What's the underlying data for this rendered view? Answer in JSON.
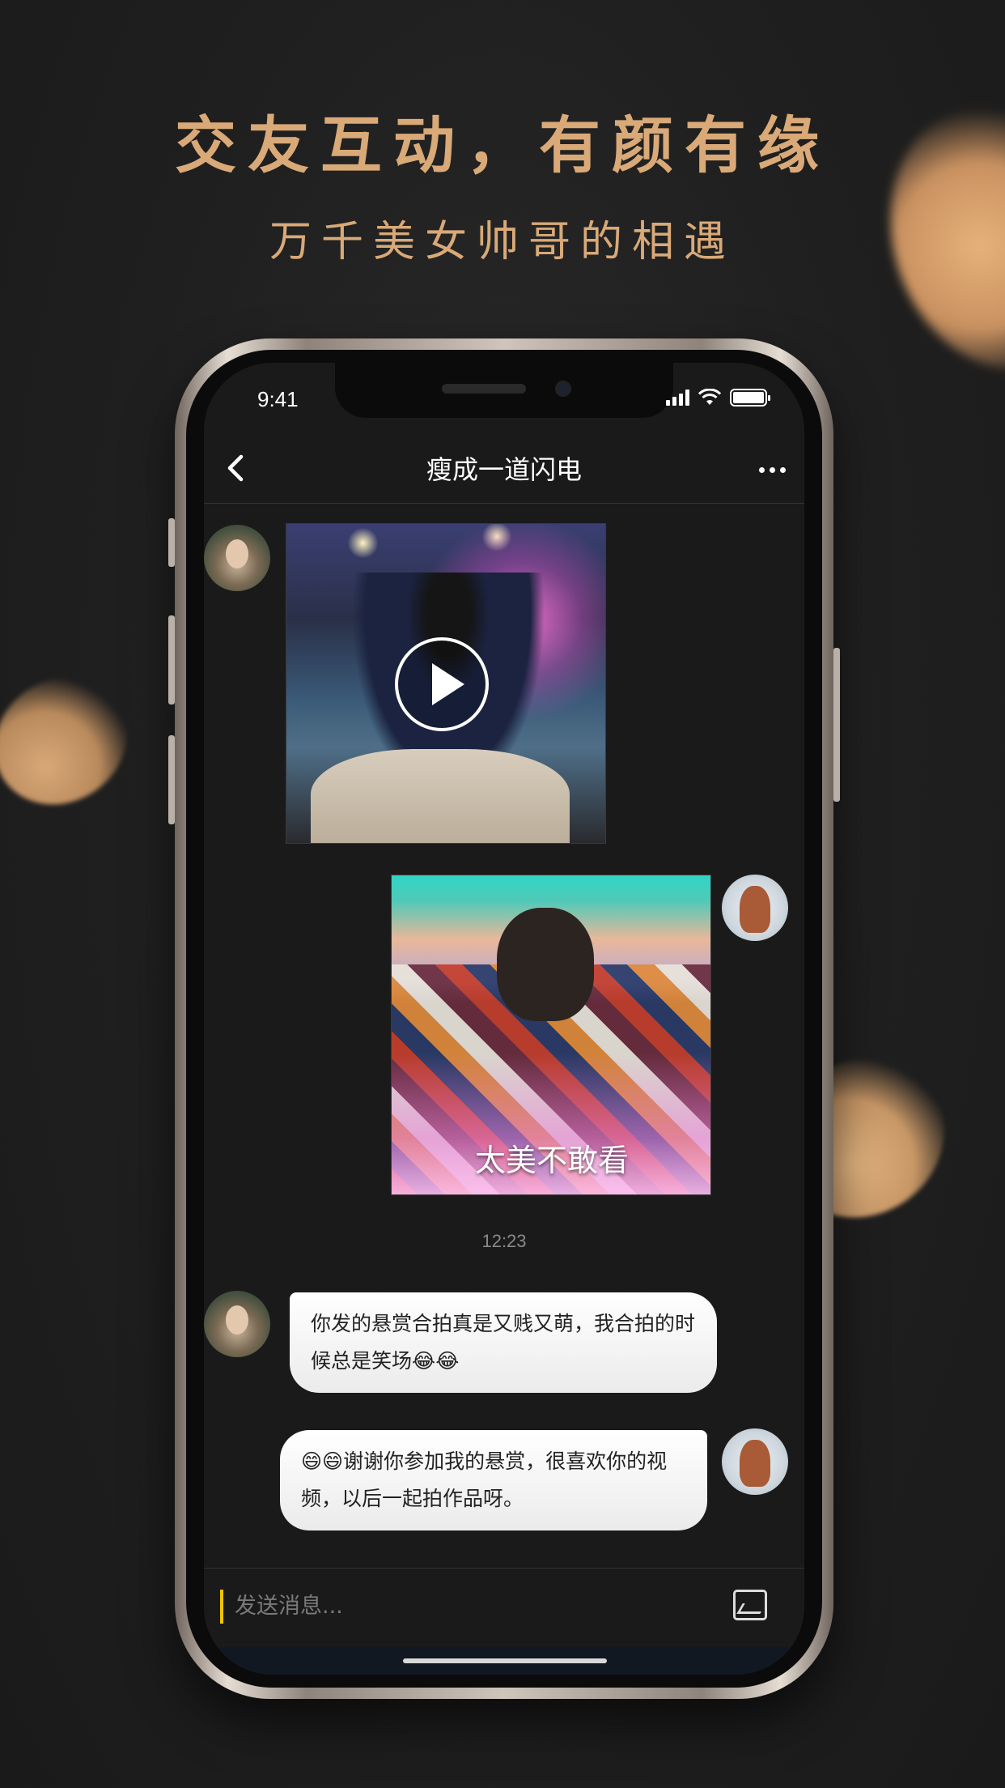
{
  "promo": {
    "headline": "交友互动，有颜有缘",
    "subline": "万千美女帅哥的相遇"
  },
  "status_bar": {
    "time": "9:41"
  },
  "nav": {
    "title": "瘦成一道闪电"
  },
  "messages": [
    {
      "side": "left",
      "type": "video",
      "sender_avatar": "girl-avatar"
    },
    {
      "side": "right",
      "type": "image",
      "caption": "太美不敢看",
      "sender_avatar": "boy-avatar"
    },
    {
      "type": "timestamp",
      "text": "12:23"
    },
    {
      "side": "left",
      "type": "text",
      "text": "你发的悬赏合拍真是又贱又萌，我合拍的时候总是笑场😂😂"
    },
    {
      "side": "right",
      "type": "text",
      "text": "😄😄谢谢你参加我的悬赏，很喜欢你的视频，以后一起拍作品呀。"
    }
  ],
  "input": {
    "placeholder": "发送消息..."
  },
  "colors": {
    "accent_gold": "#d9a978",
    "input_caret": "#f2c400",
    "background": "#1f1f1f"
  },
  "icons": [
    "back-icon",
    "more-icon",
    "play-icon",
    "image-icon",
    "signal-icon",
    "wifi-icon",
    "battery-icon"
  ]
}
